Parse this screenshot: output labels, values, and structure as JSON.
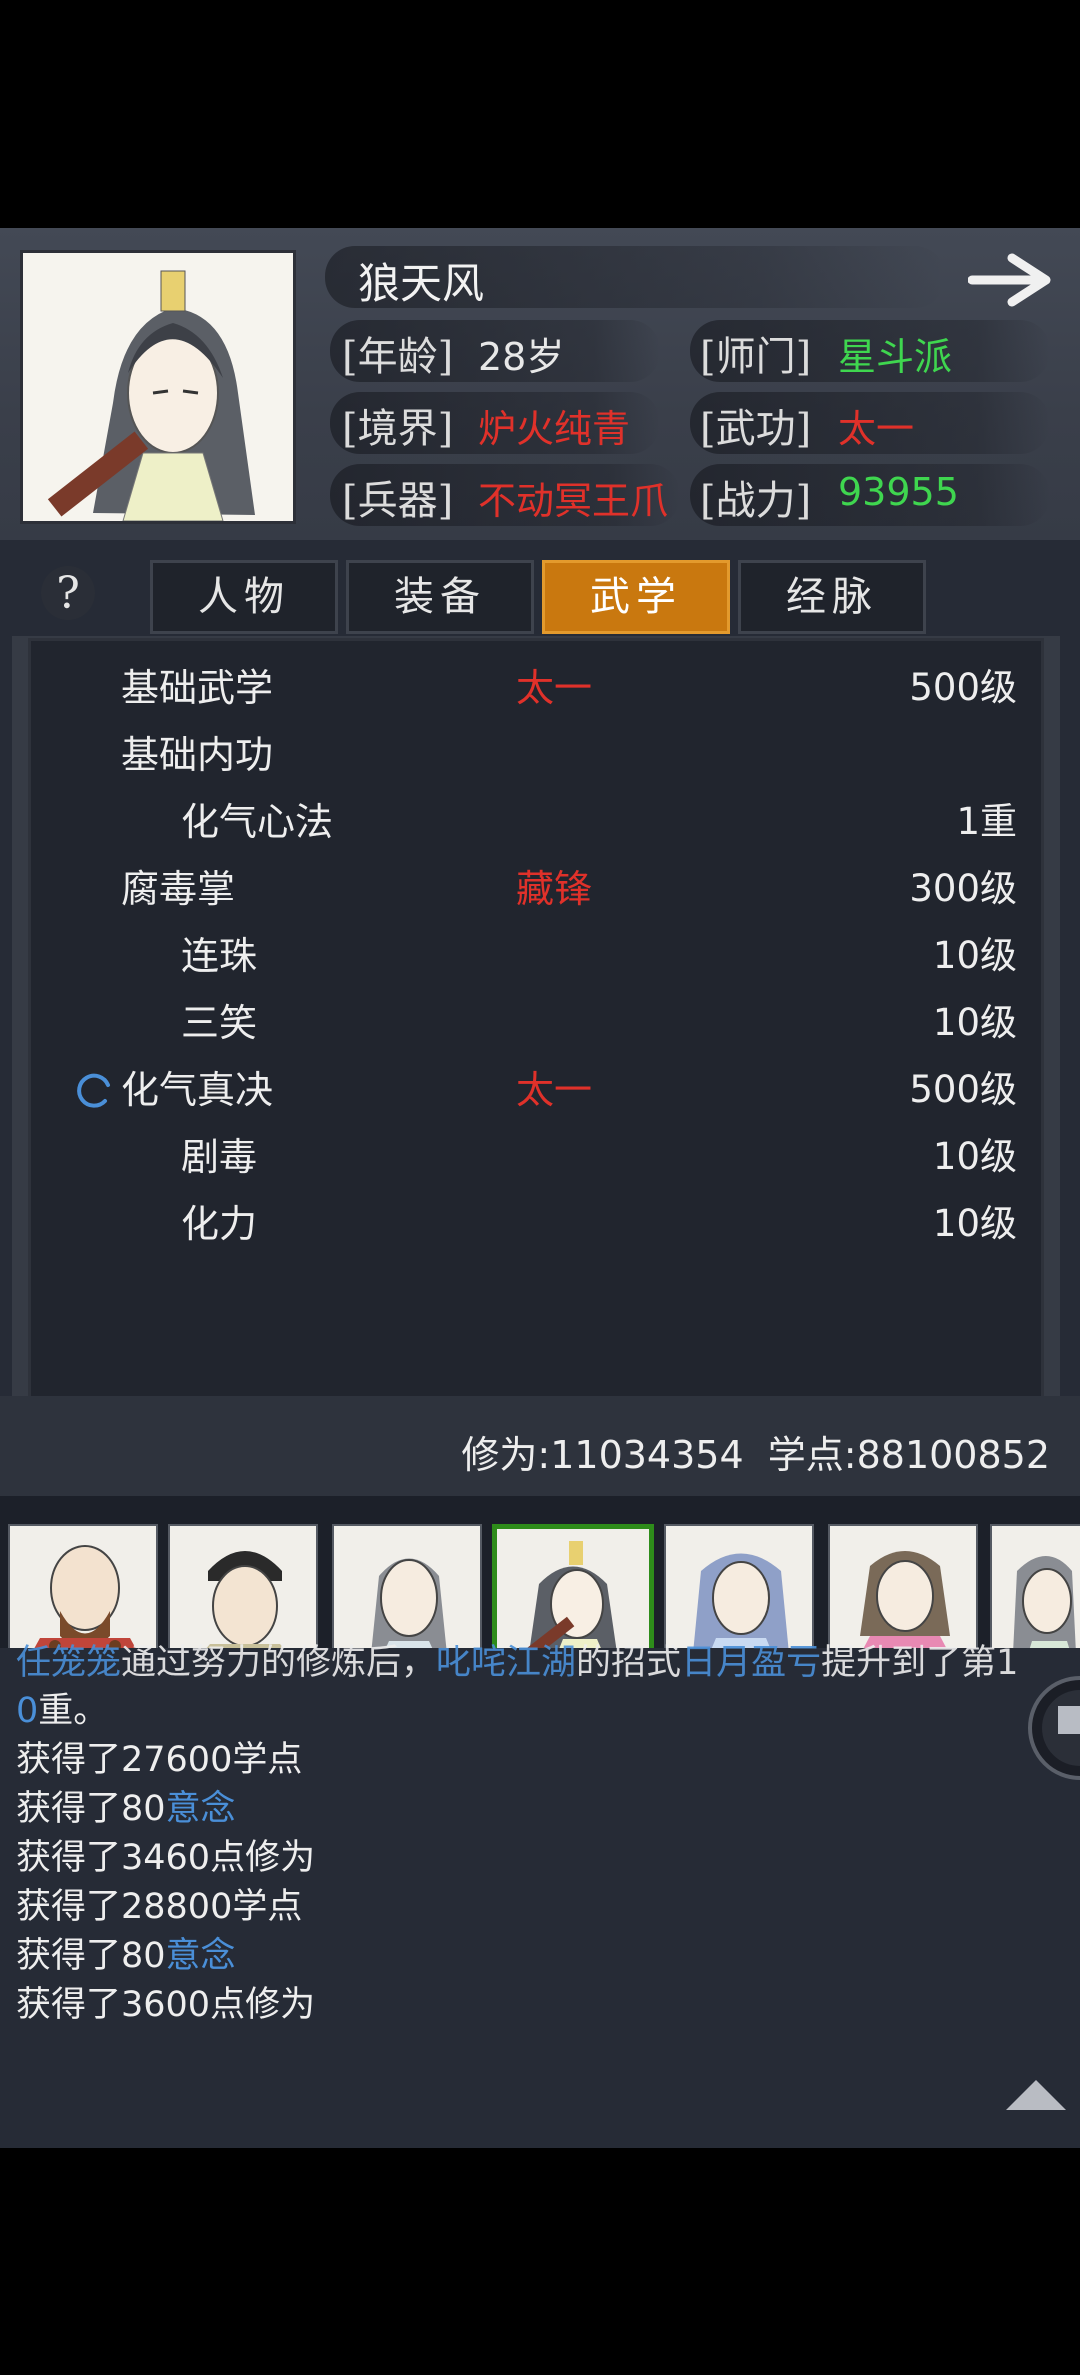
{
  "header": {
    "name": "狼天风",
    "info": [
      {
        "label": "[年龄]",
        "value": "28岁",
        "color": "#e8e8e8"
      },
      {
        "label": "[师门]",
        "value": "星斗派",
        "color": "#3fd64f"
      },
      {
        "label": "[境界]",
        "value": "炉火纯青",
        "color": "#e0312a"
      },
      {
        "label": "[武功]",
        "value": "太一",
        "color": "#e0312a"
      },
      {
        "label": "[兵器]",
        "value": "不动冥王爪",
        "color": "#e0312a"
      },
      {
        "label": "[战力]",
        "value": "93955",
        "color": "#3fd64f"
      }
    ]
  },
  "help_icon": "?",
  "tabs": [
    {
      "label": "人物",
      "active": false
    },
    {
      "label": "装备",
      "active": false
    },
    {
      "label": "武学",
      "active": true
    },
    {
      "label": "经脉",
      "active": false
    }
  ],
  "skills": [
    {
      "name": "基础武学",
      "tag": "太一",
      "level": "500级",
      "indent": 0
    },
    {
      "name": "基础内功",
      "tag": "",
      "level": "",
      "indent": 0
    },
    {
      "name": "化气心法",
      "tag": "",
      "level": "1重",
      "indent": 1
    },
    {
      "name": "腐毒掌",
      "tag": "藏锋",
      "level": "300级",
      "indent": 0
    },
    {
      "name": "连珠",
      "tag": "",
      "level": "10级",
      "indent": 1
    },
    {
      "name": "三笑",
      "tag": "",
      "level": "10级",
      "indent": 1
    },
    {
      "name": "化气真决",
      "tag": "太一",
      "level": "500级",
      "indent": 0,
      "loading": true
    },
    {
      "name": "剧毒",
      "tag": "",
      "level": "10级",
      "indent": 1
    },
    {
      "name": "化力",
      "tag": "",
      "level": "10级",
      "indent": 1
    }
  ],
  "stats": {
    "text": "修为:11034354  学点:88100852"
  },
  "log": {
    "line1": {
      "p1": "任笼笼",
      "p2": "通过努力的修炼后，",
      "p3": "叱咤江湖",
      "p4": "的招式",
      "p5": "日月盈亏",
      "p6": "提升到了第1"
    },
    "line2": {
      "p1": "0",
      "p2": "重。"
    },
    "lines": [
      {
        "text": "获得了27600学点"
      },
      {
        "text": "获得了80",
        "hl": "意念"
      },
      {
        "text": "获得了3460点修为"
      },
      {
        "text": "获得了28800学点"
      },
      {
        "text": "获得了80",
        "hl": "意念"
      },
      {
        "text": "获得了3600点修为"
      }
    ]
  }
}
